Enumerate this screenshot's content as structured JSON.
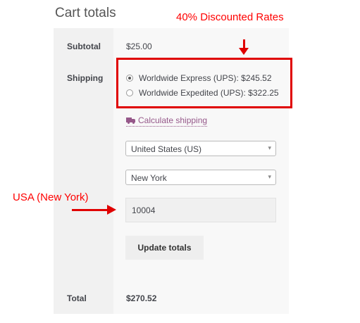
{
  "cart": {
    "title": "Cart totals",
    "subtotal_label": "Subtotal",
    "subtotal_value": "$25.00",
    "shipping_label": "Shipping",
    "shipping_options": [
      {
        "label": "Worldwide Express (UPS): $245.52",
        "selected": true
      },
      {
        "label": "Worldwide Expedited (UPS): $322.25",
        "selected": false
      }
    ],
    "calculate_shipping_label": "Calculate shipping",
    "country_value": "United States (US)",
    "state_value": "New York",
    "postcode_value": "10004",
    "update_button_label": "Update totals",
    "total_label": "Total",
    "total_value": "$270.52"
  },
  "annotations": {
    "discount_note": "40% Discounted Rates",
    "location_note": "USA (New York)"
  },
  "icons": {
    "calculate_shipping": "truck-icon",
    "select_arrow": "caret-down-icon"
  },
  "colors": {
    "link": "#96588a",
    "annotation": "#e00000"
  }
}
